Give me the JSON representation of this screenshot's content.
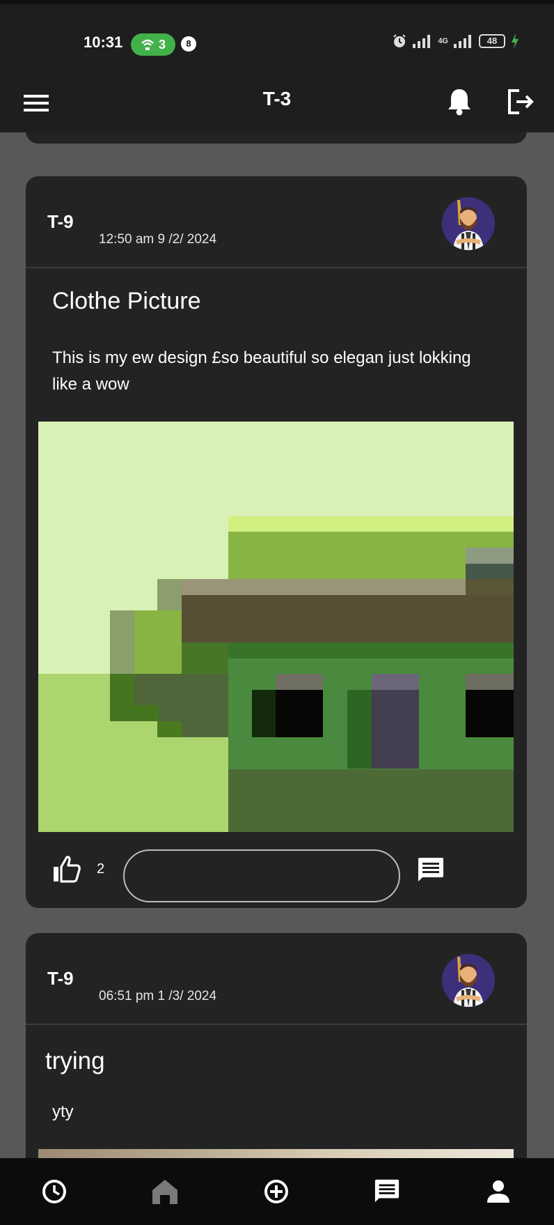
{
  "status_bar": {
    "time": "10:31",
    "hotspot_count": "3",
    "notification_count": "8",
    "battery": "48",
    "network_label": "4G"
  },
  "app_bar": {
    "title": "T-3",
    "menu_icon": "menu-icon",
    "bell_icon": "bell-icon",
    "logout_icon": "logout-icon"
  },
  "posts": [
    {
      "user": "T-9",
      "timestamp": "12:50 am  9 /2/ 2024",
      "title": "Clothe Picture",
      "body": "This is my ew design £so beautiful so elegan just lokking like a wow",
      "likes": "2",
      "comment_placeholder": ""
    },
    {
      "user": "T-9",
      "timestamp": "06:51 pm  1 /3/ 2024",
      "title": "trying",
      "body": "yty"
    }
  ],
  "bottom_nav": {
    "items": [
      "history-icon",
      "home-icon",
      "add-circle-icon",
      "chat-icon",
      "profile-icon"
    ]
  },
  "colors": {
    "background": "#585858",
    "card": "#232323",
    "bar": "#1e1e1e",
    "accent_green": "#43b14a"
  }
}
